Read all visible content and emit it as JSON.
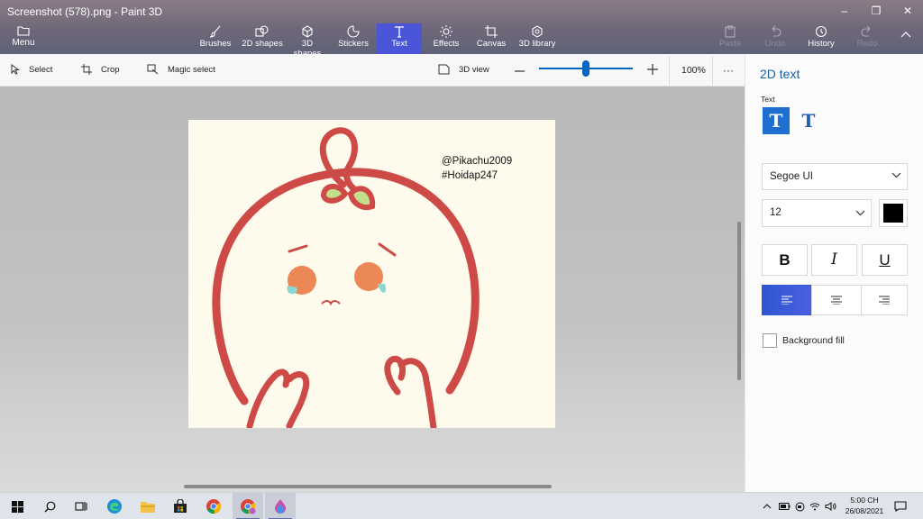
{
  "window": {
    "title": "Screenshot (578).png - Paint 3D",
    "controls": {
      "minimize": "–",
      "maximize": "❐",
      "close": "✕"
    }
  },
  "ribbon": {
    "menu_label": "Menu",
    "tools": [
      {
        "label": "Brushes",
        "icon": "brush-icon",
        "state": "normal"
      },
      {
        "label": "2D shapes",
        "icon": "2d-shapes-icon",
        "state": "normal"
      },
      {
        "label": "3D shapes",
        "icon": "3d-shapes-icon",
        "state": "normal"
      },
      {
        "label": "Stickers",
        "icon": "stickers-icon",
        "state": "normal"
      },
      {
        "label": "Text",
        "icon": "text-icon",
        "state": "active"
      },
      {
        "label": "Effects",
        "icon": "effects-icon",
        "state": "normal"
      },
      {
        "label": "Canvas",
        "icon": "canvas-icon",
        "state": "normal"
      },
      {
        "label": "3D library",
        "icon": "3d-library-icon",
        "state": "normal"
      }
    ],
    "history_tools": [
      {
        "label": "Paste",
        "icon": "paste-icon",
        "state": "disabled"
      },
      {
        "label": "Undo",
        "icon": "undo-icon",
        "state": "disabled"
      },
      {
        "label": "History",
        "icon": "history-icon",
        "state": "normal"
      },
      {
        "label": "Redo",
        "icon": "redo-icon",
        "state": "disabled"
      }
    ],
    "active_color": "#4a55d8"
  },
  "toolbar2": {
    "select_label": "Select",
    "crop_label": "Crop",
    "magic_select_label": "Magic select",
    "view3d_label": "3D view",
    "zoom_level": "100%",
    "zoom_slider_fraction": 0.5,
    "more_label": "···"
  },
  "canvas": {
    "watermark_line1": "@Pikachu2009",
    "watermark_line2": "#Hoidap247",
    "background_color": "#fefaec"
  },
  "panel": {
    "title": "2D text",
    "text_section_label": "Text",
    "text_type_2d": "T",
    "text_type_3d": "T",
    "font_name": "Segoe UI",
    "font_size": "12",
    "text_color": "#000000",
    "bold_label": "B",
    "italic_label": "I",
    "underline_label": "U",
    "alignment_selected": "left",
    "background_fill_label": "Background fill",
    "background_fill_checked": false
  },
  "taskbar": {
    "apps": [
      "start-icon",
      "search-icon",
      "task-view-icon",
      "edge-icon",
      "file-explorer-icon",
      "store-icon",
      "chrome-icon",
      "chrome-profile-icon",
      "paint-3d-icon"
    ],
    "clock_time": "5:00 CH",
    "clock_date": "26/08/2021"
  }
}
